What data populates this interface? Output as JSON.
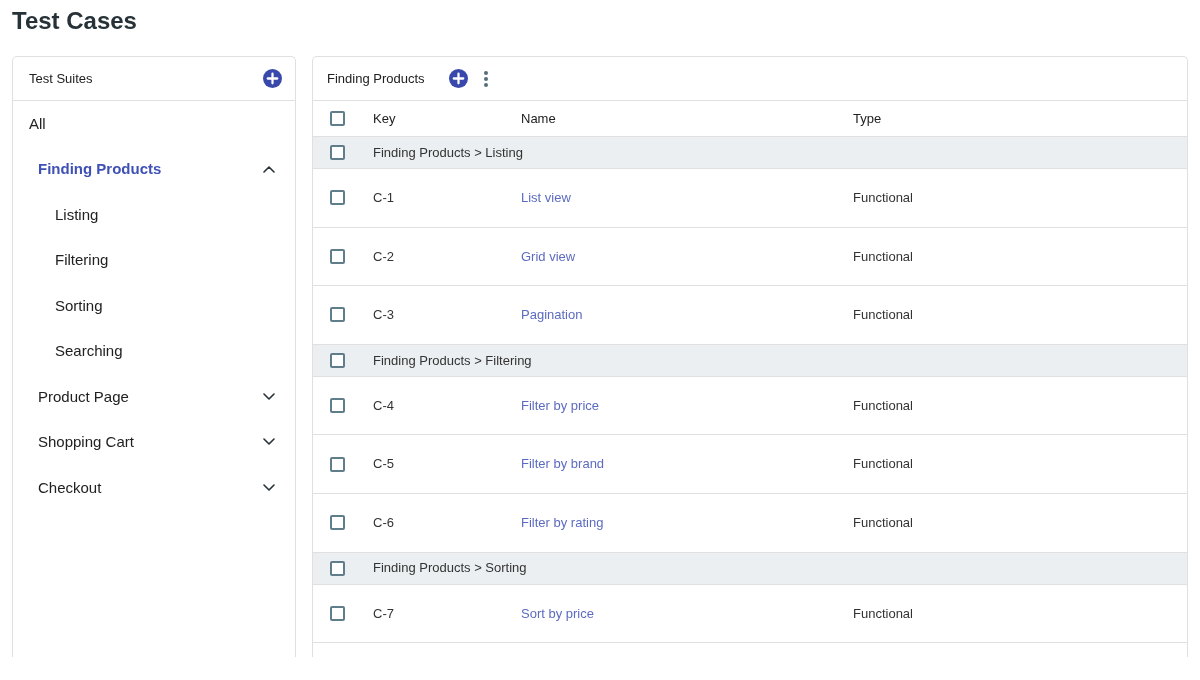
{
  "page": {
    "title": "Test Cases"
  },
  "sidebar": {
    "title": "Test Suites",
    "all_item": {
      "label": "All",
      "selected": false
    },
    "suites": [
      {
        "label": "Finding Products",
        "selected": true,
        "expanded": true,
        "children": [
          {
            "label": "Listing",
            "selected": false
          },
          {
            "label": "Filtering",
            "selected": false
          },
          {
            "label": "Sorting",
            "selected": false
          },
          {
            "label": "Searching",
            "selected": false
          }
        ]
      },
      {
        "label": "Product Page",
        "selected": false,
        "expanded": false
      },
      {
        "label": "Shopping Cart",
        "selected": false,
        "expanded": false
      },
      {
        "label": "Checkout",
        "selected": false,
        "expanded": false
      }
    ]
  },
  "content": {
    "title": "Finding Products",
    "table": {
      "header_checked": false,
      "columns": [
        "Key",
        "Name",
        "Type"
      ],
      "groups": [
        {
          "title": "Finding Products > Listing",
          "checked": false,
          "rows": [
            {
              "key": "C-1",
              "name": "List view",
              "type": "Functional",
              "checked": false
            },
            {
              "key": "C-2",
              "name": "Grid view",
              "type": "Functional",
              "checked": false
            },
            {
              "key": "C-3",
              "name": "Pagination",
              "type": "Functional",
              "checked": false
            }
          ]
        },
        {
          "title": "Finding Products > Filtering",
          "checked": false,
          "rows": [
            {
              "key": "C-4",
              "name": "Filter by price",
              "type": "Functional",
              "checked": false
            },
            {
              "key": "C-5",
              "name": "Filter by brand",
              "type": "Functional",
              "checked": false
            },
            {
              "key": "C-6",
              "name": "Filter by rating",
              "type": "Functional",
              "checked": false
            }
          ]
        },
        {
          "title": "Finding Products > Sorting",
          "checked": false,
          "rows": [
            {
              "key": "C-7",
              "name": "Sort by price",
              "type": "Functional",
              "checked": false
            }
          ]
        }
      ]
    }
  }
}
